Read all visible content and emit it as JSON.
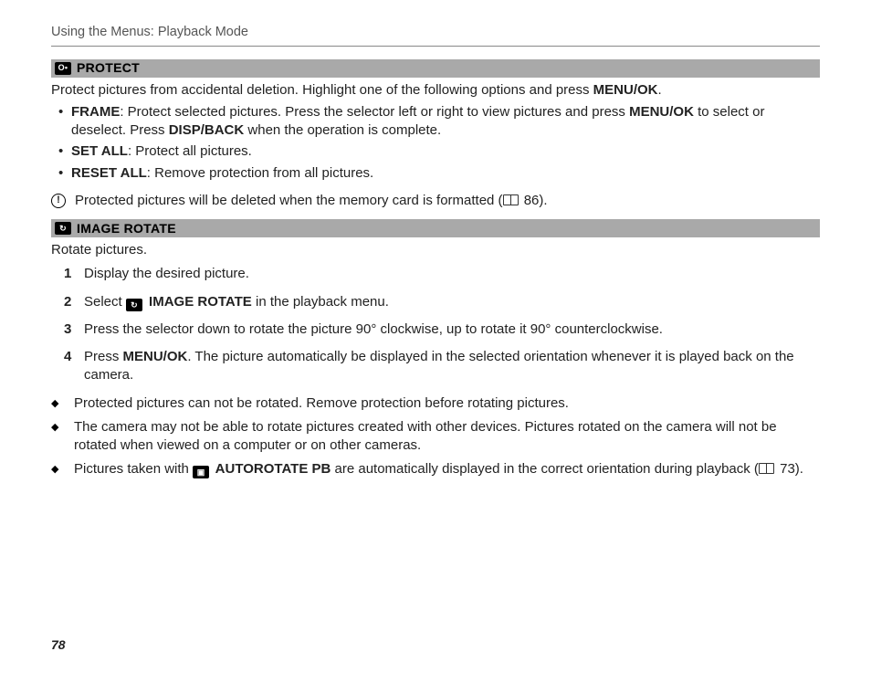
{
  "header": {
    "running_head": "Using the Menus: Playback Mode"
  },
  "protect": {
    "icon_label": "O•",
    "title": "PROTECT",
    "intro_a": "Protect pictures from accidental deletion.  Highlight one of the following options and press ",
    "intro_b_bold": "MENU/OK",
    "intro_c": ".",
    "items": {
      "frame": {
        "label": "FRAME",
        "t1": ": Protect selected pictures.  Press the selector left or right to view pictures and press ",
        "b1": "MENU/OK",
        "t2": " to select or deselect.  Press ",
        "b2": "DISP/BACK",
        "t3": " when the operation is complete."
      },
      "setall": {
        "label": "SET ALL",
        "t": ": Protect all pictures."
      },
      "resetall": {
        "label": "RESET ALL",
        "t": ": Remove protection from all pictures."
      }
    },
    "caution": {
      "t1": "Protected pictures will be deleted when the memory card is formatted (",
      "page": " 86).",
      "pn": "86"
    }
  },
  "rotate": {
    "icon_label": "↻",
    "title": "IMAGE ROTATE",
    "intro": "Rotate pictures.",
    "steps": {
      "s1": {
        "n": "1",
        "t": "Display the desired picture."
      },
      "s2": {
        "n": "2",
        "t1": "Select ",
        "icon": "↻",
        "b": " IMAGE ROTATE",
        "t2": " in the playback menu."
      },
      "s3": {
        "n": "3",
        "t": "Press the selector down to rotate the picture 90° clockwise, up to rotate it 90° counterclockwise."
      },
      "s4": {
        "n": "4",
        "t1": "Press ",
        "b": "MENU/OK",
        "t2": ".  The picture automatically be displayed in the selected orientation whenever it is played back on the camera."
      }
    },
    "notes": {
      "n1": "Protected pictures can not be rotated.  Remove protection before rotating pictures.",
      "n2": "The camera may not be able to rotate pictures created with other devices.  Pictures rotated on the camera will not be rotated when viewed on a computer or on other cameras.",
      "n3_a": "Pictures taken with ",
      "n3_icon": "▣",
      "n3_b_bold": " AUTOROTATE PB",
      "n3_c": " are automatically displayed in the correct orientation during playback (",
      "n3_pn": "73",
      "n3_d": " 73)."
    }
  },
  "page_number": "78"
}
